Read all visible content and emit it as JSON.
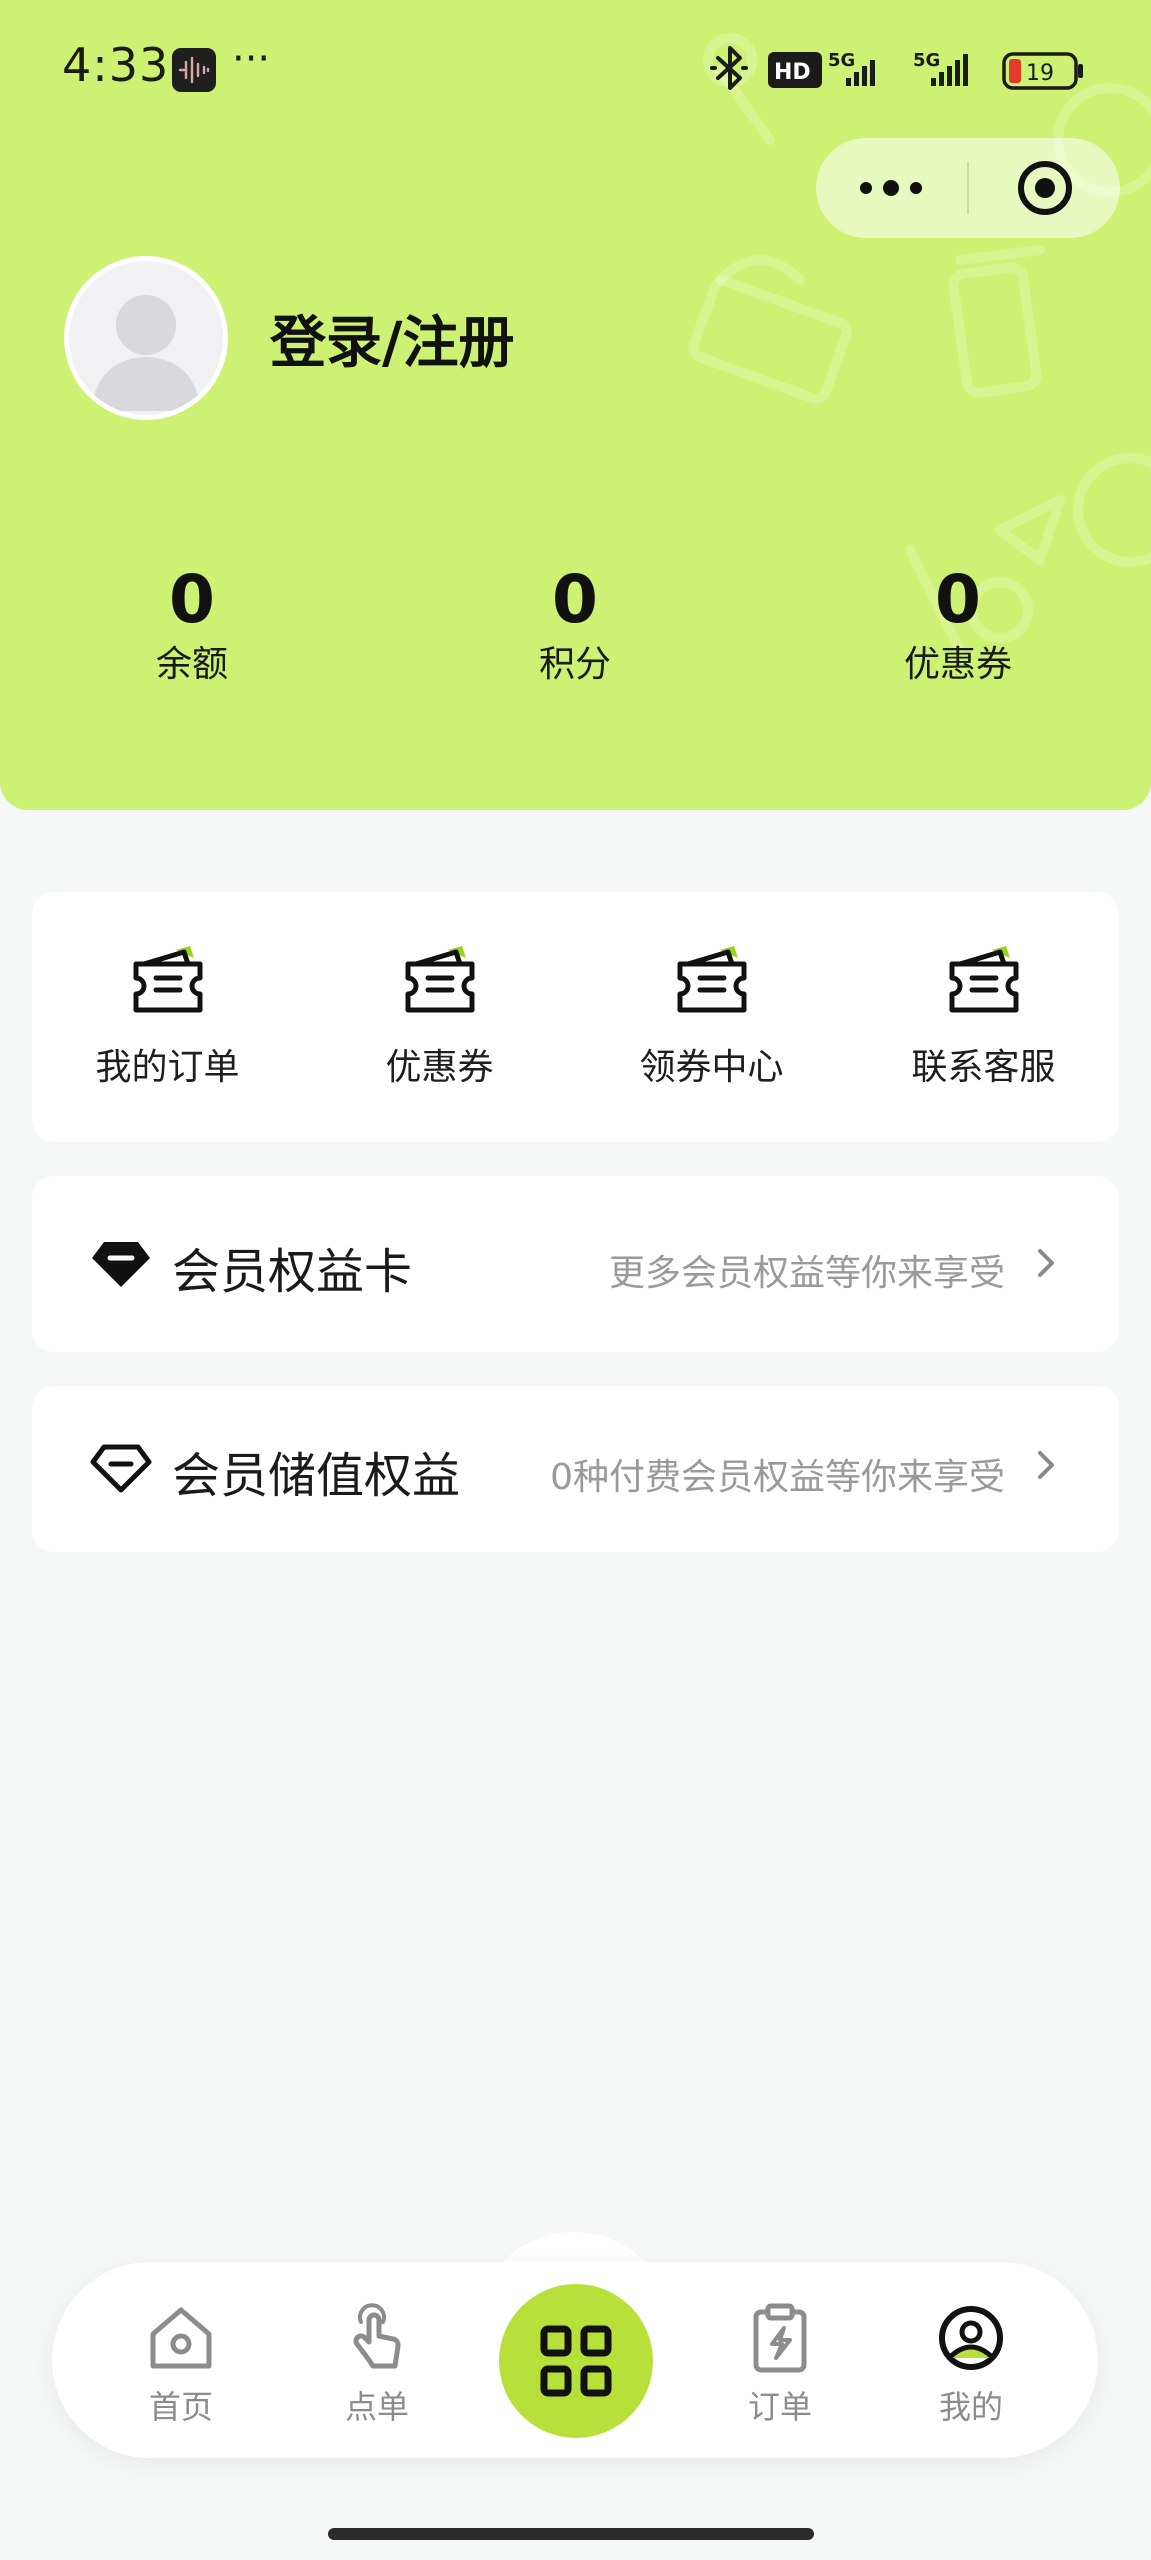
{
  "status_bar": {
    "time": "4:33",
    "more": "···",
    "hd_label": "HD",
    "net1": "5G",
    "net2": "5G",
    "battery": "19",
    "icons": [
      "app-icon",
      "bluetooth-icon",
      "signal-icon",
      "battery-icon"
    ]
  },
  "header": {
    "login_label": "登录/注册",
    "stats": [
      {
        "value": "0",
        "label": "余额"
      },
      {
        "value": "0",
        "label": "积分"
      },
      {
        "value": "0",
        "label": "优惠券"
      }
    ]
  },
  "shortcuts": [
    {
      "label": "我的订单",
      "icon": "ticket-icon"
    },
    {
      "label": "优惠券",
      "icon": "ticket-icon"
    },
    {
      "label": "领券中心",
      "icon": "ticket-icon"
    },
    {
      "label": "联系客服",
      "icon": "ticket-icon"
    }
  ],
  "member_card": {
    "title": "会员权益卡",
    "subtitle": "更多会员权益等你来享受",
    "icon": "diamond-filled-icon"
  },
  "member_stored": {
    "title": "会员储值权益",
    "subtitle": "0种付费会员权益等你来享受",
    "icon": "diamond-outline-icon"
  },
  "tabbar": {
    "tabs": [
      {
        "label": "首页",
        "icon": "home-icon"
      },
      {
        "label": "点单",
        "icon": "tap-hand-icon"
      },
      {
        "label": "订单",
        "icon": "clipboard-icon"
      },
      {
        "label": "我的",
        "icon": "profile-icon"
      }
    ],
    "center_icon": "qr-code-icon",
    "active_tab": "我的"
  },
  "colors": {
    "brand_green": "#cdf173",
    "scan_button": "#b7e03a",
    "background": "#f6f7f7",
    "ticket_accent": "#9bd11f"
  }
}
